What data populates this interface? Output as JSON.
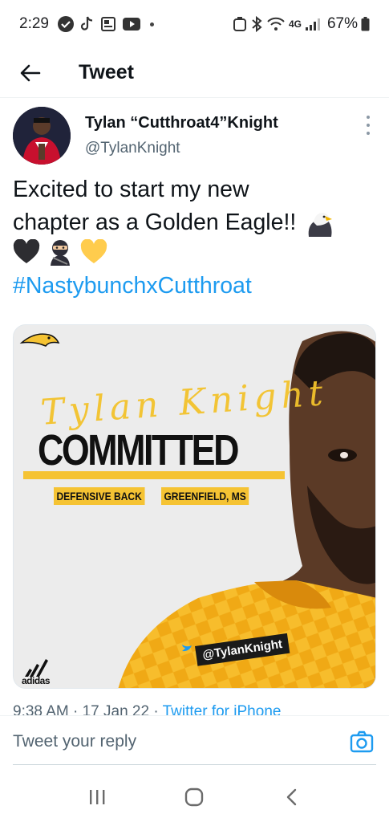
{
  "status_bar": {
    "time": "2:29",
    "network": "4G",
    "battery": "67%"
  },
  "header": {
    "title": "Tweet"
  },
  "tweet": {
    "author_name": "Tylan “Cutthroat4”Knight",
    "author_handle": "@TylanKnight",
    "text_line1": "Excited to start my new",
    "text_line2": "chapter as a Golden Eagle!!",
    "emojis": [
      "eagle-emoji",
      "black-heart-emoji",
      "ninja-emoji",
      "yellow-heart-emoji"
    ],
    "hashtag": "#NastybunchxCutthroat",
    "timestamp": "9:38 AM · 17 Jan 22 · ",
    "source": "Twitter for iPhone"
  },
  "media": {
    "script_name": "Tylan Knight",
    "headline": "COMMITTED",
    "position": "DEFENSIVE BACK",
    "location": "GREENFIELD, MS",
    "handle": "@TylanKnight",
    "brand": "adidas"
  },
  "reply": {
    "placeholder": "Tweet your reply"
  },
  "colors": {
    "accent": "#1d9bf0",
    "gold": "#f5c333",
    "text": "#0f1419",
    "secondary": "#536471"
  }
}
